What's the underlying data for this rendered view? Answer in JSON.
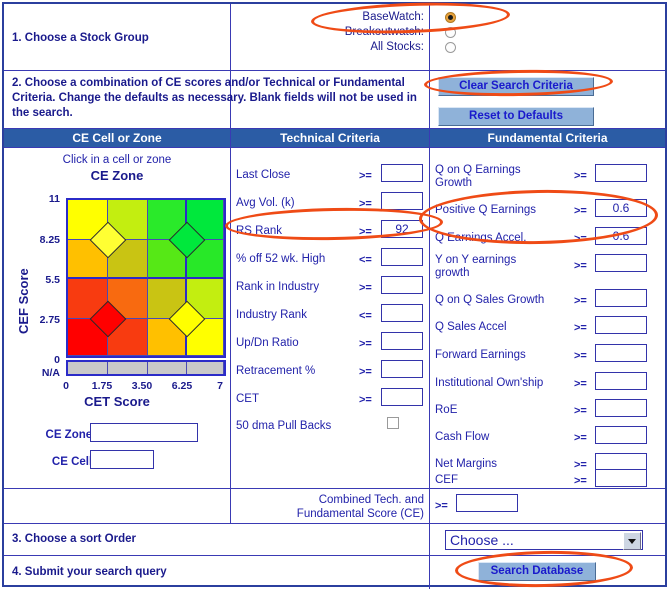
{
  "steps": {
    "step1": "1. Choose a Stock Group",
    "step2": "2. Choose a combination of CE scores and/or Technical or Fundamental Criteria. Change the defaults as necessary. Blank fields will not be used in the search.",
    "step3": "3. Choose a sort Order",
    "step4": "4. Submit your search query"
  },
  "stock_group": {
    "options": [
      {
        "label": "BaseWatch:",
        "selected": true
      },
      {
        "label": "Breakoutwatch:",
        "selected": false
      },
      {
        "label": "All Stocks:",
        "selected": false
      }
    ]
  },
  "buttons": {
    "clear": "Clear Search Criteria",
    "reset": "Reset to Defaults",
    "search": "Search Database"
  },
  "headers": {
    "ce": "CE Cell or Zone",
    "technical": "Technical Criteria",
    "fundamental": "Fundamental Criteria"
  },
  "ce_panel": {
    "hint": "Click in a cell or zone",
    "chart_title": "CE Zone",
    "zone_label": "CE Zone:",
    "cell_label": "CE Cell:",
    "zone_value": "",
    "cell_value": ""
  },
  "chart_data": {
    "type": "heatmap",
    "title": "CE Zone",
    "xlabel": "CET Score",
    "ylabel": "CEF Score",
    "xticks": [
      "0",
      "1.75",
      "3.50",
      "6.25",
      "7"
    ],
    "yticks": [
      "11",
      "8.25",
      "5.5",
      "2.75",
      "0",
      "N/A"
    ],
    "xlim": [
      0,
      7
    ],
    "ylim": [
      0,
      11
    ],
    "grid": true,
    "legend": "none",
    "rows": 4,
    "cols": 4,
    "cell_colors": [
      [
        "#ffff00",
        "#c3ee10",
        "#2aea2a",
        "#00e83c"
      ],
      [
        "#ffc000",
        "#c9c413",
        "#56e816",
        "#28e828"
      ],
      [
        "#f83b10",
        "#f86a10",
        "#c9c413",
        "#c3ee10"
      ],
      [
        "#ff0000",
        "#f83b10",
        "#ffc000",
        "#ffff00"
      ]
    ],
    "na_row_color": "#c9c9c9",
    "markers": [
      {
        "row_boundary": 1,
        "col_boundary": 1,
        "color": "#ffff33",
        "label": "zone-marker-upper-left"
      },
      {
        "row_boundary": 1,
        "col_boundary": 3,
        "color": "#00e83c",
        "label": "zone-marker-upper-right"
      },
      {
        "row_boundary": 3,
        "col_boundary": 1,
        "color": "#ff0000",
        "label": "zone-marker-lower-left"
      },
      {
        "row_boundary": 3,
        "col_boundary": 3,
        "color": "#ffff00",
        "label": "zone-marker-lower-right"
      }
    ]
  },
  "technical": {
    "rows": [
      {
        "label": "Last Close",
        "op": ">=",
        "value": ""
      },
      {
        "label": "Avg Vol. (k)",
        "op": ">=",
        "value": ""
      },
      {
        "label": "RS Rank",
        "op": ">=",
        "value": "92"
      },
      {
        "label": "% off 52 wk. High",
        "op": "<=",
        "value": ""
      },
      {
        "label": "Rank in Industry",
        "op": ">=",
        "value": ""
      },
      {
        "label": "Industry Rank",
        "op": "<=",
        "value": ""
      },
      {
        "label": "Up/Dn Ratio",
        "op": ">=",
        "value": ""
      },
      {
        "label": "Retracement %",
        "op": ">=",
        "value": ""
      },
      {
        "label": "CET",
        "op": ">=",
        "value": ""
      }
    ],
    "checkbox": {
      "label": "50 dma Pull Backs",
      "checked": false
    }
  },
  "fundamental": {
    "rows": [
      {
        "label": "Q on Q Earnings Growth",
        "op": ">=",
        "value": ""
      },
      {
        "label": "Positive Q Earnings",
        "op": ">=",
        "value": "0.6"
      },
      {
        "label": "Q Earnings Accel.",
        "op": ">=",
        "value": "0.6"
      },
      {
        "label": "Y on Y earnings growth",
        "op": ">=",
        "value": ""
      },
      {
        "label": "Q on Q Sales Growth",
        "op": ">=",
        "value": ""
      },
      {
        "label": "Q Sales Accel",
        "op": ">=",
        "value": ""
      },
      {
        "label": "Forward Earnings",
        "op": ">=",
        "value": ""
      },
      {
        "label": "Institutional Own'ship",
        "op": ">=",
        "value": ""
      },
      {
        "label": "RoE",
        "op": ">=",
        "value": ""
      },
      {
        "label": "Cash Flow",
        "op": ">=",
        "value": ""
      },
      {
        "label": "Net Margins",
        "op": ">=",
        "value": ""
      },
      {
        "label": "CEF",
        "op": ">=",
        "value": ""
      }
    ]
  },
  "combined": {
    "label_line1": "Combined Tech. and",
    "label_line2": "Fundamental Score (CE)",
    "op": ">=",
    "value": ""
  },
  "sort_order": {
    "selected": "Choose ..."
  },
  "colors": {
    "header_bg": "#2b5ca5",
    "border": "#2b3f9e",
    "text": "#2222aa",
    "button_bg": "#8fb2d9",
    "annotation": "#ef4b16",
    "radio_on": "#e8a33d"
  }
}
